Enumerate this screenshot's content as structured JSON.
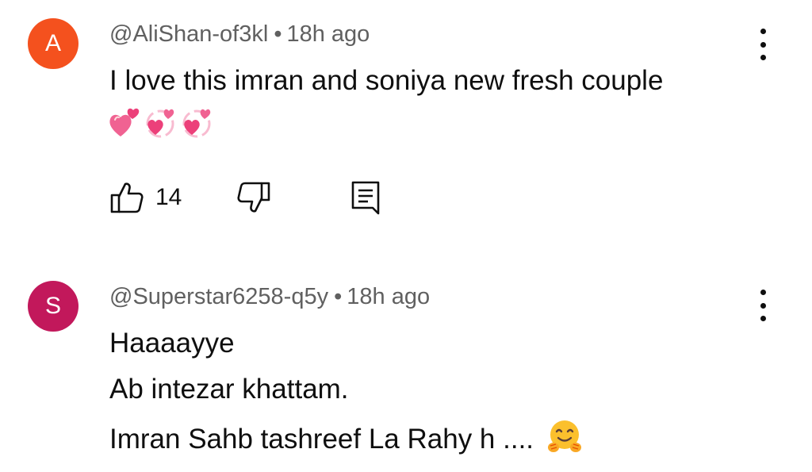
{
  "comments": [
    {
      "avatar_letter": "A",
      "avatar_color": "#f4511e",
      "handle": "@AliShan-of3kl",
      "separator": "•",
      "time": "18h ago",
      "lines": [
        "I love this imran and soniya new fresh couple"
      ],
      "emojis": [
        "two-hearts-emoji",
        "revolving-hearts-emoji",
        "revolving-hearts-emoji"
      ],
      "likes": "14"
    },
    {
      "avatar_letter": "S",
      "avatar_color": "#c2185b",
      "handle": "@Superstar6258-q5y",
      "separator": "•",
      "time": "18h ago",
      "lines": [
        "Haaaayye",
        "Ab intezar khattam.",
        "Imran Sahb tashreef La Rahy h ...."
      ],
      "emojis": [
        "hugging-face-emoji"
      ]
    }
  ],
  "icons": {
    "like": "thumbs-up-icon",
    "dislike": "thumbs-down-icon",
    "reply": "reply-comment-icon",
    "menu": "more-vertical-icon"
  }
}
